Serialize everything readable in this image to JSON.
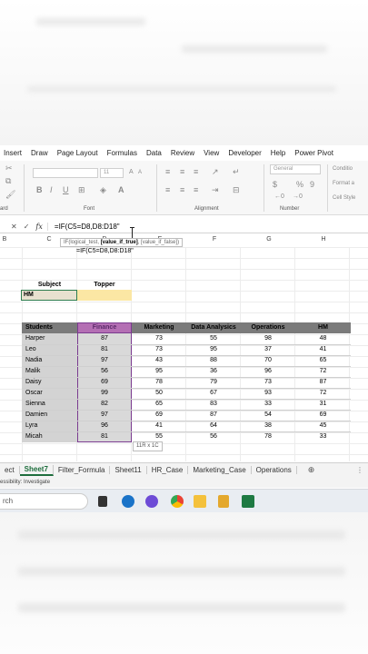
{
  "ribbon": {
    "tabs": [
      "Insert",
      "Draw",
      "Page Layout",
      "Formulas",
      "Data",
      "Review",
      "View",
      "Developer",
      "Help",
      "Power Pivot"
    ],
    "font_name": "",
    "font_size": "11",
    "number_format": "General",
    "groups": {
      "clipboard": "ard",
      "font": "Font",
      "alignment": "Alignment",
      "number": "Number"
    },
    "styles_items": [
      "Conditio",
      "Format a",
      "Cell Style"
    ],
    "bold": "B",
    "italic": "I",
    "underline": "U",
    "currency": "$",
    "percent": "%",
    "comma": "9"
  },
  "formula_bar": {
    "cancel": "✕",
    "enter": "✓",
    "fx": "fx",
    "formula": "=IF(C5=D8,D8:D18\""
  },
  "column_headers": [
    "B",
    "C",
    "D",
    "E",
    "F",
    "G",
    "H"
  ],
  "tooltip": {
    "prefix": "IF(logical_test, ",
    "bold_arg": "[value_if_true]",
    "suffix": ", [value_if_false])"
  },
  "in_cell_formula": "=IF(C5=D8,D8:D18\"",
  "lookup": {
    "subject_label": "Subject",
    "topper_label": "Topper",
    "subject_value": "HM",
    "topper_value": ""
  },
  "table": {
    "headers": [
      "Students",
      "Finance",
      "Marketing",
      "Data Analysics",
      "Operations",
      "HM"
    ],
    "rows": [
      [
        "Harper",
        "87",
        "73",
        "55",
        "98",
        "48"
      ],
      [
        "Leo",
        "81",
        "73",
        "95",
        "37",
        "41"
      ],
      [
        "Nadia",
        "97",
        "43",
        "88",
        "70",
        "65"
      ],
      [
        "Malik",
        "56",
        "95",
        "36",
        "96",
        "72"
      ],
      [
        "Daisy",
        "69",
        "78",
        "79",
        "73",
        "87"
      ],
      [
        "Oscar",
        "99",
        "50",
        "67",
        "93",
        "72"
      ],
      [
        "Sienna",
        "82",
        "65",
        "83",
        "33",
        "31"
      ],
      [
        "Damien",
        "97",
        "69",
        "87",
        "54",
        "69"
      ],
      [
        "Lyra",
        "96",
        "41",
        "64",
        "38",
        "45"
      ],
      [
        "Micah",
        "81",
        "55",
        "56",
        "78",
        "33"
      ]
    ]
  },
  "selection_dims": "11R x 1C",
  "sheet_tabs": [
    "ect",
    "Sheet7",
    "Filter_Formula",
    "Sheet11",
    "HR_Case",
    "Marketing_Case",
    "Operations"
  ],
  "active_sheet": "Sheet7",
  "add_sheet": "⊕",
  "more_sheets": "⋮",
  "status_text": "essibility: Investigate",
  "taskbar": {
    "search": "rch"
  }
}
